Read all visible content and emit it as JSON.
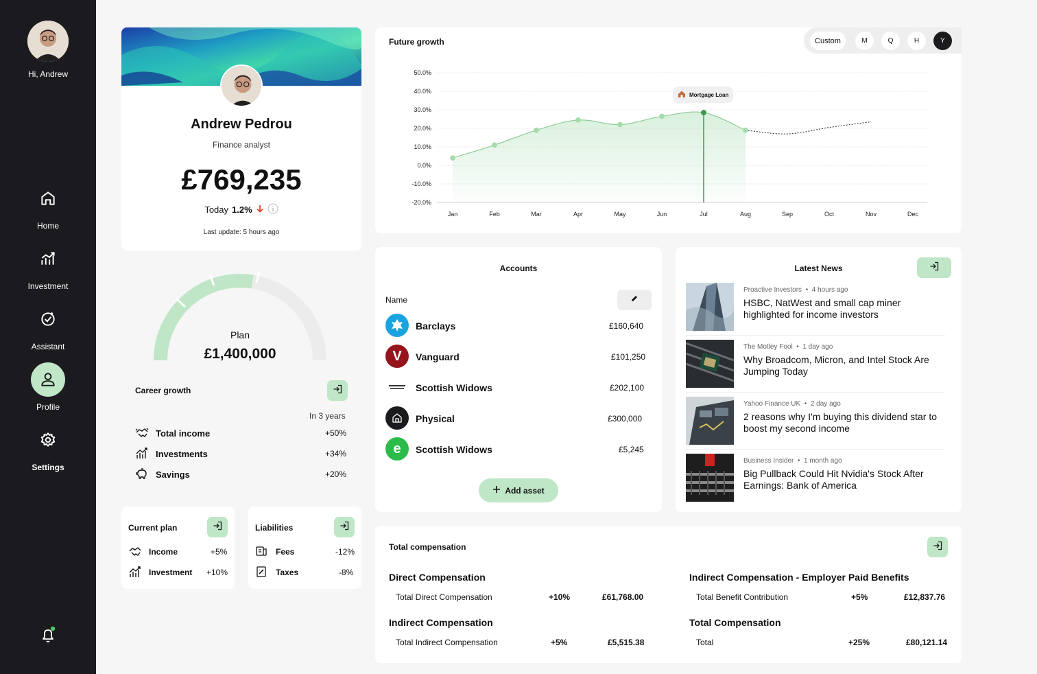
{
  "sidebar": {
    "greeting": "Hi, Andrew",
    "items": [
      {
        "label": "Home"
      },
      {
        "label": "Investment"
      },
      {
        "label": "Assistant"
      },
      {
        "label": "Profile"
      },
      {
        "label": "Settings"
      }
    ]
  },
  "profile": {
    "name": "Andrew Pedrou",
    "role": "Finance analyst",
    "balance": "£769,235",
    "today_label": "Today",
    "today_change": "1.2%",
    "last_update": "Last update: 5 hours ago"
  },
  "plan": {
    "label": "Plan",
    "amount": "£1,400,000",
    "progress_fraction": 0.55
  },
  "career": {
    "title": "Career growth",
    "period": "In 3 years",
    "rows": [
      {
        "label": "Total income",
        "value": "+50%"
      },
      {
        "label": "Investments",
        "value": "+34%"
      },
      {
        "label": "Savings",
        "value": "+20%"
      }
    ]
  },
  "current_plan": {
    "title": "Current plan",
    "rows": [
      {
        "label": "Income",
        "value": "+5%"
      },
      {
        "label": "Investment",
        "value": "+10%"
      }
    ]
  },
  "liabilities": {
    "title": "Liabilities",
    "rows": [
      {
        "label": "Fees",
        "value": "-12%"
      },
      {
        "label": "Taxes",
        "value": "-8%"
      }
    ]
  },
  "growth": {
    "title": "Future growth",
    "periods": [
      "Custom",
      "M",
      "Q",
      "H",
      "Y"
    ],
    "active_period": "Y",
    "annotation": "Mortgage Loan"
  },
  "chart_data": {
    "type": "line",
    "title": "Future growth",
    "x": [
      "Jan",
      "Feb",
      "Mar",
      "Apr",
      "May",
      "Jun",
      "Jul",
      "Aug",
      "Sep",
      "Oct",
      "Nov",
      "Dec"
    ],
    "y_ticks": [
      "50.0%",
      "40.0%",
      "30.0%",
      "20.0%",
      "10.0%",
      "0.0%",
      "-10.0%",
      "-20.0%"
    ],
    "ylim": [
      -20,
      50
    ],
    "series": [
      {
        "values": [
          4,
          11,
          19,
          24.5,
          22,
          26.5,
          28.5,
          19
        ]
      },
      {
        "values": [
          null,
          null,
          null,
          null,
          null,
          null,
          null,
          19,
          17,
          20.5,
          23.5,
          null
        ],
        "style": "dotted"
      }
    ],
    "highlight": {
      "x": "Jul",
      "label": "Mortgage Loan"
    },
    "grid": true
  },
  "accounts": {
    "title": "Accounts",
    "name_header": "Name",
    "add_label": "Add asset",
    "rows": [
      {
        "name": "Barclays",
        "amount": "£160,640"
      },
      {
        "name": "Vanguard",
        "amount": "£101,250"
      },
      {
        "name": "Scottish Widows",
        "amount": "£202,100"
      },
      {
        "name": "Physical",
        "amount": "£300,000"
      },
      {
        "name": "Scottish Widows",
        "amount": "£5,245"
      }
    ]
  },
  "news": {
    "title": "Latest News",
    "items": [
      {
        "source": "Proactive Investors",
        "time": "4 hours ago",
        "headline": "HSBC, NatWest and small cap miner highlighted for income investors"
      },
      {
        "source": "The Motley Fool",
        "time": "1 day ago",
        "headline": "Why Broadcom, Micron, and Intel Stock Are Jumping Today"
      },
      {
        "source": "Yahoo Finance UK",
        "time": "2 day ago",
        "headline": "2 reasons why I'm buying this dividend star to boost my second income"
      },
      {
        "source": "Business Insider",
        "time": "1 month ago",
        "headline": "Big Pullback Could Hit Nvidia's Stock After Earnings: Bank of America"
      }
    ]
  },
  "compensation": {
    "title": "Total compensation",
    "direct": {
      "heading": "Direct Compensation",
      "label": "Total Direct Compensation",
      "change": "+10%",
      "amount": "£61,768.00"
    },
    "indirect": {
      "heading": "Indirect Compensation",
      "label": "Total Indirect Compensation",
      "change": "+5%",
      "amount": "£5,515.38"
    },
    "benefits": {
      "heading": "Indirect Compensation - Employer Paid Benefits",
      "label": "Total Benefit Contribution",
      "change": "+5%",
      "amount": "£12,837.76"
    },
    "total": {
      "heading": "Total Compensation",
      "label": "Total",
      "change": "+25%",
      "amount": "£80,121.14"
    }
  },
  "colors": {
    "accent": "#bfe6c6",
    "line": "#8ccc96",
    "point": "#a4dbaa",
    "highlight": "#3a9a4a",
    "down": "#e0462a",
    "sidebar": "#1b1b1f"
  }
}
